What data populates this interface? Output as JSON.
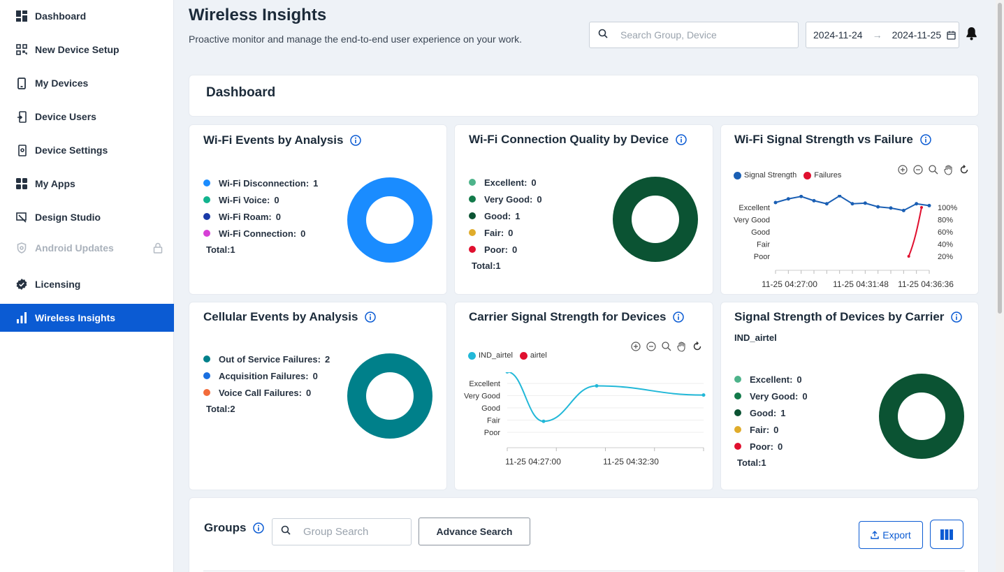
{
  "sidebar": {
    "items": [
      {
        "label": "Dashboard",
        "icon": "grid-icon"
      },
      {
        "label": "New Device Setup",
        "icon": "qr-icon"
      },
      {
        "label": "My Devices",
        "icon": "phone-icon"
      },
      {
        "label": "Device Users",
        "icon": "user-device-icon"
      },
      {
        "label": "Device Settings",
        "icon": "device-settings-icon"
      },
      {
        "label": "My Apps",
        "icon": "apps-icon"
      },
      {
        "label": "Design Studio",
        "icon": "design-icon"
      },
      {
        "label": "Android Updates",
        "icon": "shield-icon",
        "disabled": true
      },
      {
        "label": "Licensing",
        "icon": "badge-check-icon"
      },
      {
        "label": "Wireless Insights",
        "icon": "bar-chart-icon",
        "active": true
      }
    ]
  },
  "header": {
    "title": "Wireless Insights",
    "subtitle": "Proactive monitor and manage the end-to-end user experience on your work.",
    "search_placeholder": "Search Group, Device",
    "date_from": "2024-11-24",
    "date_arrow": "→",
    "date_to": "2024-11-25"
  },
  "dashboard": {
    "title": "Dashboard"
  },
  "colors": {
    "accent": "#0b5bd3",
    "wifi_disconnection": "#1a8cff",
    "wifi_voice": "#12b38e",
    "wifi_roam": "#1a3aa8",
    "wifi_connection": "#d63fd6",
    "excellent": "#4db38a",
    "very_good": "#137a4a",
    "good": "#0b5333",
    "fair": "#e0ac2b",
    "poor": "#e0102f",
    "out_of_service": "#00808a",
    "acquisition": "#1a6fe0",
    "voice_call": "#f26b3a"
  },
  "wifi_events": {
    "title": "Wi-Fi Events by Analysis",
    "items": [
      {
        "name": "Wi-Fi Disconnection:",
        "value": "1",
        "color": "#1a8cff"
      },
      {
        "name": "Wi-Fi Voice:",
        "value": "0",
        "color": "#12b38e"
      },
      {
        "name": "Wi-Fi Roam:",
        "value": "0",
        "color": "#1a3aa8"
      },
      {
        "name": "Wi-Fi Connection:",
        "value": "0",
        "color": "#d63fd6"
      }
    ],
    "total": "Total:1"
  },
  "wifi_quality": {
    "title": "Wi-Fi Connection Quality by Device",
    "items": [
      {
        "name": "Excellent:",
        "value": "0",
        "color": "#4db38a"
      },
      {
        "name": "Very Good:",
        "value": "0",
        "color": "#137a4a"
      },
      {
        "name": "Good:",
        "value": "1",
        "color": "#0b5333"
      },
      {
        "name": "Fair:",
        "value": "0",
        "color": "#e0ac2b"
      },
      {
        "name": "Poor:",
        "value": "0",
        "color": "#e0102f"
      }
    ],
    "total": "Total:1"
  },
  "wifi_signal": {
    "title": "Wi-Fi Signal Strength vs Failure",
    "legend": [
      "Signal Strength",
      "Failures"
    ]
  },
  "cellular_events": {
    "title": "Cellular Events by Analysis",
    "items": [
      {
        "name": "Out of Service Failures:",
        "value": "2",
        "color": "#00808a"
      },
      {
        "name": "Acquisition Failures:",
        "value": "0",
        "color": "#1a6fe0"
      },
      {
        "name": "Voice Call Failures:",
        "value": "0",
        "color": "#f26b3a"
      }
    ],
    "total": "Total:2"
  },
  "carrier_signal": {
    "title": "Carrier Signal Strength for Devices",
    "legend": [
      "IND_airtel",
      "airtel"
    ]
  },
  "carrier_devices": {
    "title": "Signal Strength of Devices by Carrier",
    "carrier": "IND_airtel",
    "items": [
      {
        "name": "Excellent:",
        "value": "0",
        "color": "#4db38a"
      },
      {
        "name": "Very Good:",
        "value": "0",
        "color": "#137a4a"
      },
      {
        "name": "Good:",
        "value": "1",
        "color": "#0b5333"
      },
      {
        "name": "Fair:",
        "value": "0",
        "color": "#e0ac2b"
      },
      {
        "name": "Poor:",
        "value": "0",
        "color": "#e0102f"
      }
    ],
    "total": "Total:1"
  },
  "groups": {
    "title": "Groups",
    "search_placeholder": "Group Search",
    "advance_label": "Advance Search",
    "export_label": "Export"
  },
  "chart_data": [
    {
      "type": "pie",
      "title": "Wi-Fi Events by Analysis",
      "categories": [
        "Wi-Fi Disconnection",
        "Wi-Fi Voice",
        "Wi-Fi Roam",
        "Wi-Fi Connection"
      ],
      "values": [
        1,
        0,
        0,
        0
      ]
    },
    {
      "type": "pie",
      "title": "Wi-Fi Connection Quality by Device",
      "categories": [
        "Excellent",
        "Very Good",
        "Good",
        "Fair",
        "Poor"
      ],
      "values": [
        0,
        0,
        1,
        0,
        0
      ]
    },
    {
      "type": "line",
      "title": "Wi-Fi Signal Strength vs Failure",
      "y_categories": [
        "Poor",
        "Fair",
        "Good",
        "Very Good",
        "Excellent"
      ],
      "y2_ticks": [
        "20%",
        "40%",
        "60%",
        "80%",
        "100%"
      ],
      "x_ticks": [
        "11-25 04:27:00",
        "11-25 04:31:48",
        "11-25 04:36:36"
      ],
      "series": [
        {
          "name": "Signal Strength",
          "color": "#1a5fb4",
          "values": [
            4.4,
            4.7,
            4.9,
            4.55,
            4.3,
            4.95,
            4.3,
            4.35,
            4.05,
            3.95,
            3.75,
            4.3,
            4.15
          ]
        },
        {
          "name": "Failures",
          "color": "#e0102f",
          "values": [
            null,
            null,
            null,
            null,
            null,
            null,
            null,
            null,
            null,
            null,
            null,
            0.0,
            1.0
          ]
        }
      ]
    },
    {
      "type": "pie",
      "title": "Cellular Events by Analysis",
      "categories": [
        "Out of Service Failures",
        "Acquisition Failures",
        "Voice Call Failures"
      ],
      "values": [
        2,
        0,
        0
      ]
    },
    {
      "type": "line",
      "title": "Carrier Signal Strength for Devices",
      "y_categories": [
        "Poor",
        "Fair",
        "Good",
        "Very Good",
        "Excellent"
      ],
      "x_ticks": [
        "11-25 04:27:00",
        "11-25 04:32:30"
      ],
      "series": [
        {
          "name": "IND_airtel",
          "color": "#22b8d8",
          "values": [
            4.95,
            0.9,
            3.8,
            3.05
          ]
        },
        {
          "name": "airtel",
          "color": "#e0102f",
          "values": []
        }
      ]
    },
    {
      "type": "pie",
      "title": "Signal Strength of Devices by Carrier",
      "categories": [
        "Excellent",
        "Very Good",
        "Good",
        "Fair",
        "Poor"
      ],
      "values": [
        0,
        0,
        1,
        0,
        0
      ]
    }
  ]
}
